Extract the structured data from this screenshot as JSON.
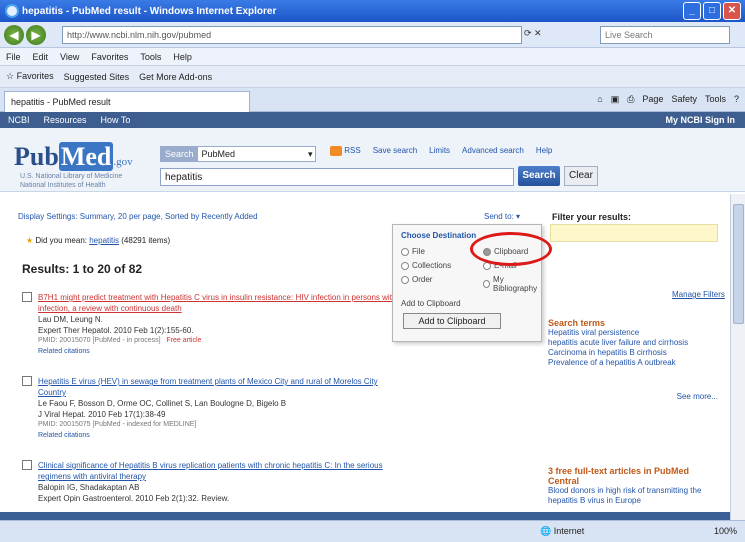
{
  "window": {
    "title": "hepatitis - PubMed result - Windows Internet Explorer"
  },
  "address": {
    "url": "http://www.ncbi.nlm.nih.gov/pubmed"
  },
  "search_engine": {
    "placeholder": "Live Search"
  },
  "menu": [
    "File",
    "Edit",
    "View",
    "Favorites",
    "Tools",
    "Help"
  ],
  "favorites": [
    "Favorites",
    "Suggested Sites",
    "Get More Add-ons"
  ],
  "tab": {
    "label": "hepatitis - PubMed result"
  },
  "command_bar": [
    "Page",
    "Safety",
    "Tools"
  ],
  "ncbi_bar": {
    "items": [
      "NCBI",
      "Resources",
      "How To"
    ],
    "right": "My NCBI Sign In"
  },
  "pubmed": {
    "logo_pub": "Pub",
    "logo_med": "Med",
    "logo_gov": ".gov",
    "logo_sub": "U.S. National Library of Medicine National Institutes of Health",
    "db_label": "Search",
    "db_value": "PubMed",
    "rss_label": "RSS",
    "save_search": "Save search",
    "limits": "Limits",
    "advanced": "Advanced search",
    "help": "Help",
    "query": "hepatitis",
    "search_btn": "Search",
    "clear_btn": "Clear"
  },
  "results_header": {
    "display_settings": "Display Settings: Summary, 20 per page, Sorted by Recently Added",
    "send_to": "Send to:",
    "did_you_mean_prefix": "Did you mean:",
    "did_you_mean_link": "hepatitis",
    "did_you_mean_suffix": "(48291 items)",
    "results_title": "Results: 1 to 20 of 82"
  },
  "popup": {
    "title": "Choose Destination",
    "opt_file": "File",
    "opt_clipboard": "Clipboard",
    "opt_collections": "Collections",
    "opt_email": "E-mail",
    "opt_order": "Order",
    "opt_mybib": "My Bibliography",
    "add_label": "Add to Clipboard",
    "add_btn": "Add to Clipboard"
  },
  "results": [
    {
      "title": "B7H1 might predict treatment with Hepatitis C virus in insulin resistance: HIV infection in persons with chronic liver",
      "title2": "infection, a review with continuous death",
      "authors": "Lau DM, Leung N.",
      "journal": "Expert Ther Hepatol. 2010 Feb 1(2):155-60.",
      "pmid": "PMID: 20015070 [PubMed - in process]",
      "free": "Free article",
      "related": "Related citations"
    },
    {
      "title": "Hepatitis E virus (HEV) in sewage from treatment plants of Mexico City and rural of Morelos City",
      "title2": "Country",
      "authors": "Le Faou F, Bosson D, Orme OC, Collinet S, Lan Boulogne D, Bigelo B",
      "journal": "J Viral Hepat. 2010 Feb 17(1):38-49",
      "pmid": "PMID: 20015075 [PubMed - indexed for MEDLINE]",
      "related": "Related citations"
    },
    {
      "title": "Clinical significance of Hepatitis B virus replication patients with chronic hepatitis C: In the serious",
      "title2": "regimens with antiviral therapy",
      "authors": "Balopin IG, Shadakaptan AB",
      "journal": "Expert Opin Gastroenterol. 2010 Feb 2(1):32. Review."
    }
  ],
  "sidebar": {
    "filter_head": "Filter your results:",
    "manage_filters": "Manage Filters",
    "panel1_head": "Search terms",
    "panel1_lines": [
      "Hepatitis viral persistence",
      "hepatitis acute liver failure and cirrhosis",
      "Carcinoma in hepatitis B cirrhosis",
      "Prevalence of a hepatitis A outbreak"
    ],
    "see_more": "See more...",
    "panel2_head": "3 free full-text articles in PubMed Central",
    "panel2_lines": [
      "Blood donors in high risk of transmitting the",
      "hepatitis B virus in Europe"
    ]
  },
  "status": {
    "text": "Internet",
    "zoom": "100%"
  }
}
